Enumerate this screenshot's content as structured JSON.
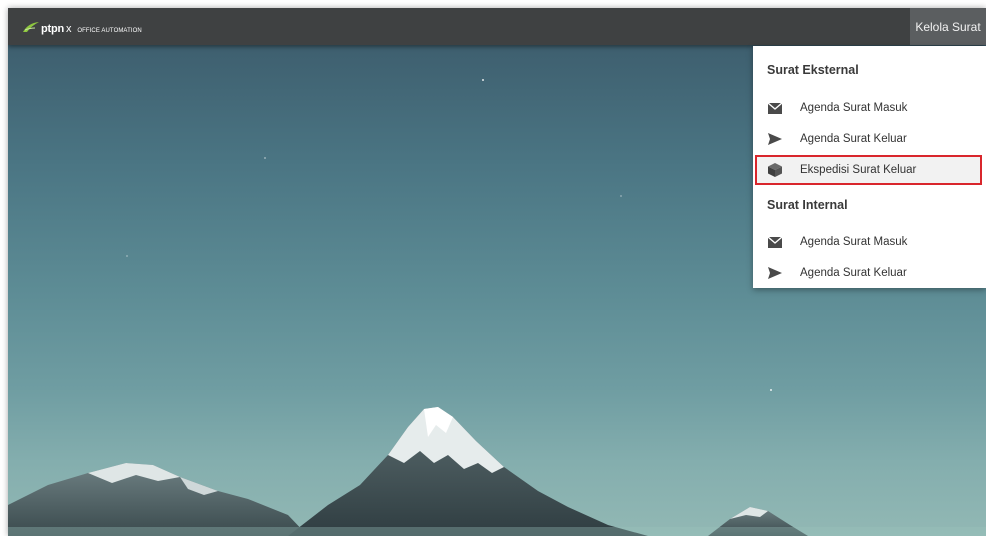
{
  "header": {
    "brand": "ptpn",
    "brand_suffix": "x",
    "tagline": "OFFICE AUTOMATION",
    "nav_button_label": "Kelola Surat"
  },
  "menu": {
    "external": {
      "title": "Surat Eksternal",
      "items": [
        {
          "label": "Agenda Surat Masuk",
          "icon": "mail-icon"
        },
        {
          "label": "Agenda Surat Keluar",
          "icon": "send-icon"
        },
        {
          "label": "Ekspedisi Surat Keluar",
          "icon": "box-icon",
          "active": true
        }
      ]
    },
    "internal": {
      "title": "Surat Internal",
      "items": [
        {
          "label": "Agenda Surat Masuk",
          "icon": "mail-icon"
        },
        {
          "label": "Agenda Surat Keluar",
          "icon": "send-icon"
        }
      ]
    }
  },
  "colors": {
    "topbar": "#3f4142",
    "nav_button": "#5b5e60",
    "highlight_border": "#d9262c",
    "logo_green": "#8dc63f"
  }
}
